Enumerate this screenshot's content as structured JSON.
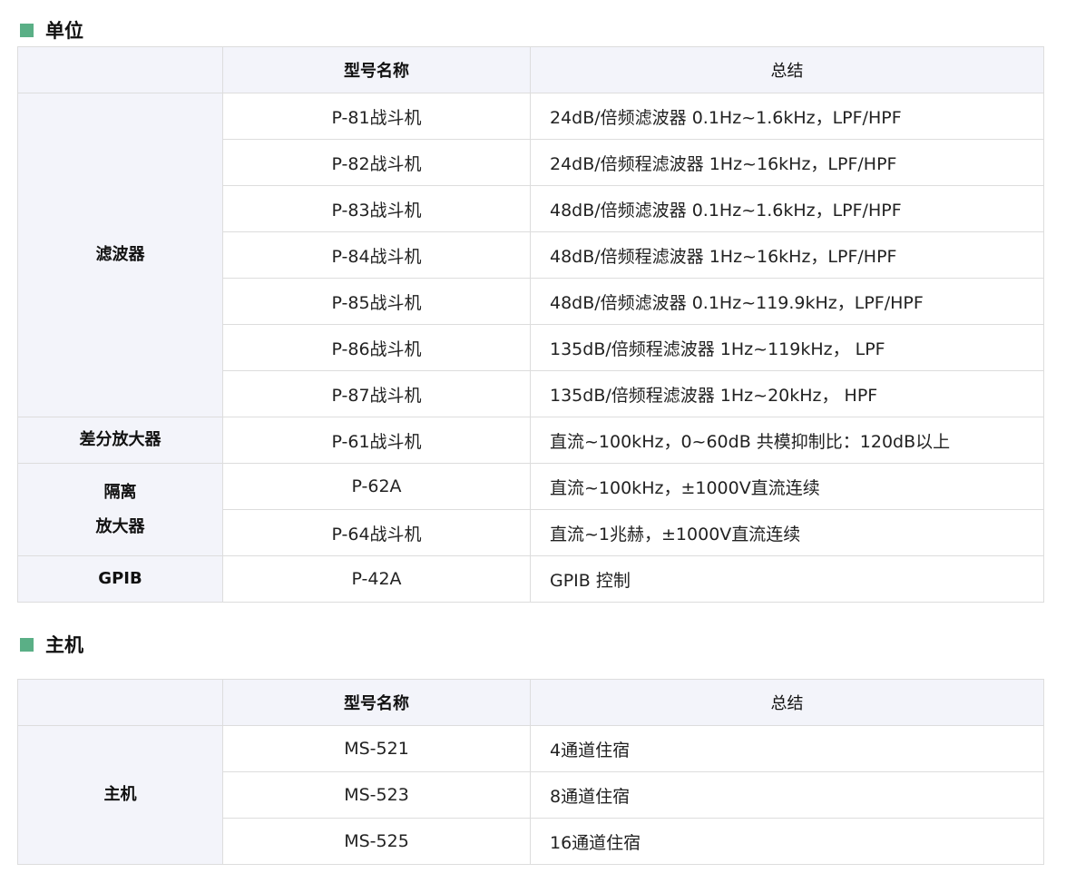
{
  "colors": {
    "accent": "#5aaf86",
    "header_bg": "#f3f4fa",
    "border": "#dddddd"
  },
  "units_section": {
    "title": "单位",
    "headers": [
      "",
      "型号名称",
      "总结"
    ],
    "groups": [
      {
        "category": "滤波器",
        "rows": [
          {
            "model": "P-81战斗机",
            "summary": "24dB/倍频滤波器 0.1Hz~1.6kHz，LPF/HPF"
          },
          {
            "model": "P-82战斗机",
            "summary": "24dB/倍频程滤波器 1Hz~16kHz，LPF/HPF"
          },
          {
            "model": "P-83战斗机",
            "summary": "48dB/倍频滤波器 0.1Hz~1.6kHz，LPF/HPF"
          },
          {
            "model": "P-84战斗机",
            "summary": "48dB/倍频程滤波器 1Hz~16kHz，LPF/HPF"
          },
          {
            "model": "P-85战斗机",
            "summary": "48dB/倍频滤波器 0.1Hz~119.9kHz，LPF/HPF"
          },
          {
            "model": "P-86战斗机",
            "summary": "135dB/倍频程滤波器 1Hz~119kHz， LPF"
          },
          {
            "model": "P-87战斗机",
            "summary": "135dB/倍频程滤波器 1Hz~20kHz， HPF"
          }
        ]
      },
      {
        "category": "差分放大器",
        "rows": [
          {
            "model": "P-61战斗机",
            "summary": "直流~100kHz，0~60dB 共模抑制比：120dB以上"
          }
        ]
      },
      {
        "category": "隔离 放大器",
        "rows": [
          {
            "model": "P-62A",
            "summary": "直流~100kHz，±1000V直流连续"
          },
          {
            "model": "P-64战斗机",
            "summary": "直流~1兆赫，±1000V直流连续"
          }
        ]
      },
      {
        "category": "GPIB",
        "rows": [
          {
            "model": "P-42A",
            "summary": "GPIB 控制"
          }
        ]
      }
    ]
  },
  "host_section": {
    "title": "主机",
    "headers": [
      "",
      "型号名称",
      "总结"
    ],
    "groups": [
      {
        "category": "主机",
        "rows": [
          {
            "model": "MS-521",
            "summary": "4通道住宿"
          },
          {
            "model": "MS-523",
            "summary": "8通道住宿"
          },
          {
            "model": "MS-525",
            "summary": "16通道住宿"
          }
        ]
      }
    ]
  }
}
